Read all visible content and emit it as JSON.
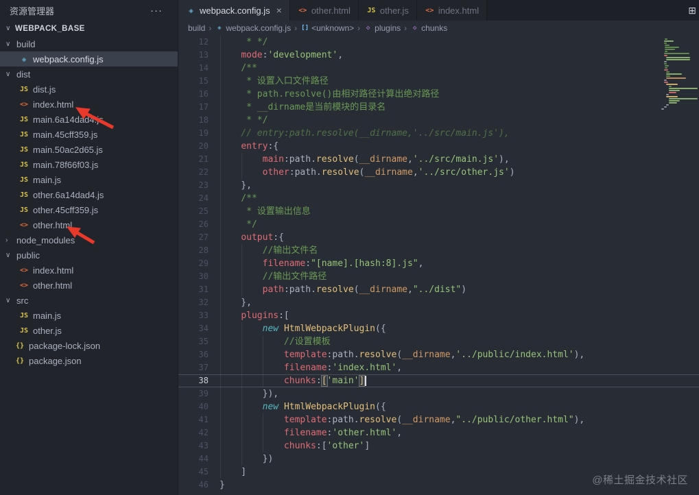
{
  "glyphs": {
    "chevron_down": "∨",
    "chevron_right": "›",
    "more": "···",
    "split_editor": "⊞",
    "close": "×",
    "breadcrumb_sep": "›"
  },
  "colors": {
    "sidebar_bg": "#21252b",
    "editor_bg": "#282c34",
    "selection_bg": "#3a404c",
    "property": "#e06c75",
    "string": "#98c379",
    "comment": "#6a9955",
    "class_fn": "#e5c07b",
    "keyword": "#56b6c2",
    "constant": "#d19a66",
    "annotation_arrow": "#e8392b"
  },
  "sidebar": {
    "title": "资源管理器",
    "section": "WEBPACK_BASE",
    "tree": [
      {
        "label": "build",
        "type": "folder",
        "expanded": true,
        "depth": 0
      },
      {
        "label": "webpack.config.js",
        "type": "webpack",
        "depth": 1,
        "selected": true
      },
      {
        "label": "dist",
        "type": "folder",
        "expanded": true,
        "depth": 0
      },
      {
        "label": "dist.js",
        "type": "js",
        "depth": 1
      },
      {
        "label": "index.html",
        "type": "html",
        "depth": 1,
        "arrow": true
      },
      {
        "label": "main.6a14dad4.js",
        "type": "js",
        "depth": 1
      },
      {
        "label": "main.45cff359.js",
        "type": "js",
        "depth": 1
      },
      {
        "label": "main.50ac2d65.js",
        "type": "js",
        "depth": 1
      },
      {
        "label": "main.78f66f03.js",
        "type": "js",
        "depth": 1
      },
      {
        "label": "main.js",
        "type": "js",
        "depth": 1
      },
      {
        "label": "other.6a14dad4.js",
        "type": "js",
        "depth": 1
      },
      {
        "label": "other.45cff359.js",
        "type": "js",
        "depth": 1
      },
      {
        "label": "other.html",
        "type": "html",
        "depth": 1,
        "arrow": true
      },
      {
        "label": "node_modules",
        "type": "folder",
        "expanded": false,
        "depth": 0
      },
      {
        "label": "public",
        "type": "folder",
        "expanded": true,
        "depth": 0
      },
      {
        "label": "index.html",
        "type": "html",
        "depth": 1
      },
      {
        "label": "other.html",
        "type": "html",
        "depth": 1
      },
      {
        "label": "src",
        "type": "folder",
        "expanded": true,
        "depth": 0
      },
      {
        "label": "main.js",
        "type": "js",
        "depth": 1
      },
      {
        "label": "other.js",
        "type": "js",
        "depth": 1
      },
      {
        "label": "package-lock.json",
        "type": "json",
        "depth": 0,
        "rootfile": true
      },
      {
        "label": "package.json",
        "type": "json",
        "depth": 0,
        "rootfile": true
      }
    ]
  },
  "tabs": [
    {
      "label": "webpack.config.js",
      "icon": "webpack",
      "active": true,
      "close": "×"
    },
    {
      "label": "other.html",
      "icon": "html"
    },
    {
      "label": "other.js",
      "icon": "js"
    },
    {
      "label": "index.html",
      "icon": "html"
    }
  ],
  "breadcrumbs": [
    {
      "label": "build"
    },
    {
      "label": "webpack.config.js",
      "icon": "webpack"
    },
    {
      "label": "<unknown>",
      "icon": "symbol-array"
    },
    {
      "label": "plugins",
      "icon": "symbol-field"
    },
    {
      "label": "chunks",
      "icon": "symbol-field"
    }
  ],
  "editor": {
    "active_line": 38,
    "lines": [
      {
        "n": 12,
        "t": [
          [
            "c",
            "     * */"
          ]
        ]
      },
      {
        "n": 13,
        "t": [
          [
            "p",
            "    "
          ],
          [
            "r",
            "mode"
          ],
          [
            "p",
            ":"
          ],
          [
            "g",
            "'development'"
          ],
          [
            "p",
            ","
          ]
        ]
      },
      {
        "n": 14,
        "t": [
          [
            "c",
            "    /**"
          ]
        ]
      },
      {
        "n": 15,
        "t": [
          [
            "c",
            "     * 设置入口文件路径"
          ]
        ]
      },
      {
        "n": 16,
        "t": [
          [
            "c",
            "     * path.resolve()由相对路径计算出绝对路径"
          ]
        ]
      },
      {
        "n": 17,
        "t": [
          [
            "c",
            "     * __dirname是当前模块的目录名"
          ]
        ]
      },
      {
        "n": 18,
        "t": [
          [
            "c",
            "     * */"
          ]
        ]
      },
      {
        "n": 19,
        "t": [
          [
            "ci",
            "    // entry:path.resolve(__dirname,'../src/main.js'),"
          ]
        ]
      },
      {
        "n": 20,
        "t": [
          [
            "p",
            "    "
          ],
          [
            "r",
            "entry"
          ],
          [
            "p",
            ":{"
          ]
        ]
      },
      {
        "n": 21,
        "t": [
          [
            "p",
            "        "
          ],
          [
            "r",
            "main"
          ],
          [
            "p",
            ":"
          ],
          [
            "v",
            "path"
          ],
          [
            "p",
            "."
          ],
          [
            "y",
            "resolve"
          ],
          [
            "p",
            "("
          ],
          [
            "o",
            "__dirname"
          ],
          [
            "p",
            ","
          ],
          [
            "g",
            "'../src/main.js'"
          ],
          [
            "p",
            "),"
          ]
        ]
      },
      {
        "n": 22,
        "t": [
          [
            "p",
            "        "
          ],
          [
            "r",
            "other"
          ],
          [
            "p",
            ":"
          ],
          [
            "v",
            "path"
          ],
          [
            "p",
            "."
          ],
          [
            "y",
            "resolve"
          ],
          [
            "p",
            "("
          ],
          [
            "o",
            "__dirname"
          ],
          [
            "p",
            ","
          ],
          [
            "g",
            "'../src/other.js'"
          ],
          [
            "p",
            ")"
          ]
        ]
      },
      {
        "n": 23,
        "t": [
          [
            "p",
            "    },"
          ]
        ]
      },
      {
        "n": 24,
        "t": [
          [
            "c",
            "    /**"
          ]
        ]
      },
      {
        "n": 25,
        "t": [
          [
            "c",
            "     * 设置输出信息"
          ]
        ]
      },
      {
        "n": 26,
        "t": [
          [
            "c",
            "     */"
          ]
        ]
      },
      {
        "n": 27,
        "t": [
          [
            "p",
            "    "
          ],
          [
            "r",
            "output"
          ],
          [
            "p",
            ":{"
          ]
        ]
      },
      {
        "n": 28,
        "t": [
          [
            "c",
            "        //输出文件名"
          ]
        ]
      },
      {
        "n": 29,
        "t": [
          [
            "p",
            "        "
          ],
          [
            "r",
            "filename"
          ],
          [
            "p",
            ":"
          ],
          [
            "g",
            "\"[name].[hash:8].js\""
          ],
          [
            "p",
            ","
          ]
        ]
      },
      {
        "n": 30,
        "t": [
          [
            "c",
            "        //输出文件路径"
          ]
        ]
      },
      {
        "n": 31,
        "t": [
          [
            "p",
            "        "
          ],
          [
            "r",
            "path"
          ],
          [
            "p",
            ":"
          ],
          [
            "v",
            "path"
          ],
          [
            "p",
            "."
          ],
          [
            "y",
            "resolve"
          ],
          [
            "p",
            "("
          ],
          [
            "o",
            "__dirname"
          ],
          [
            "p",
            ","
          ],
          [
            "g",
            "\"../dist\""
          ],
          [
            "p",
            ")"
          ]
        ]
      },
      {
        "n": 32,
        "t": [
          [
            "p",
            "    },"
          ]
        ]
      },
      {
        "n": 33,
        "t": [
          [
            "p",
            "    "
          ],
          [
            "r",
            "plugins"
          ],
          [
            "p",
            ":["
          ]
        ]
      },
      {
        "n": 34,
        "t": [
          [
            "p",
            "        "
          ],
          [
            "k",
            "new"
          ],
          [
            "p",
            " "
          ],
          [
            "y",
            "HtmlWebpackPlugin"
          ],
          [
            "p",
            "({"
          ]
        ]
      },
      {
        "n": 35,
        "t": [
          [
            "c",
            "            //设置模板"
          ]
        ]
      },
      {
        "n": 36,
        "t": [
          [
            "p",
            "            "
          ],
          [
            "r",
            "template"
          ],
          [
            "p",
            ":"
          ],
          [
            "v",
            "path"
          ],
          [
            "p",
            "."
          ],
          [
            "y",
            "resolve"
          ],
          [
            "p",
            "("
          ],
          [
            "o",
            "__dirname"
          ],
          [
            "p",
            ","
          ],
          [
            "g",
            "'../public/index.html'"
          ],
          [
            "p",
            "),"
          ]
        ]
      },
      {
        "n": 37,
        "t": [
          [
            "p",
            "            "
          ],
          [
            "r",
            "filename"
          ],
          [
            "p",
            ":"
          ],
          [
            "g",
            "'index.html'"
          ],
          [
            "p",
            ","
          ]
        ]
      },
      {
        "n": 38,
        "t": [
          [
            "p",
            "            "
          ],
          [
            "r",
            "chunks"
          ],
          [
            "p",
            ":"
          ],
          [
            "hb",
            "["
          ],
          [
            "g",
            "'main'"
          ],
          [
            "hb",
            "]"
          ]
        ]
      },
      {
        "n": 39,
        "t": [
          [
            "p",
            "        }),"
          ]
        ]
      },
      {
        "n": 40,
        "t": [
          [
            "p",
            "        "
          ],
          [
            "k",
            "new"
          ],
          [
            "p",
            " "
          ],
          [
            "y",
            "HtmlWebpackPlugin"
          ],
          [
            "p",
            "({"
          ]
        ]
      },
      {
        "n": 41,
        "t": [
          [
            "p",
            "            "
          ],
          [
            "r",
            "template"
          ],
          [
            "p",
            ":"
          ],
          [
            "v",
            "path"
          ],
          [
            "p",
            "."
          ],
          [
            "y",
            "resolve"
          ],
          [
            "p",
            "("
          ],
          [
            "o",
            "__dirname"
          ],
          [
            "p",
            ","
          ],
          [
            "g",
            "\"../public/other.html\""
          ],
          [
            "p",
            "),"
          ]
        ]
      },
      {
        "n": 42,
        "t": [
          [
            "p",
            "            "
          ],
          [
            "r",
            "filename"
          ],
          [
            "p",
            ":"
          ],
          [
            "g",
            "'other.html'"
          ],
          [
            "p",
            ","
          ]
        ]
      },
      {
        "n": 43,
        "t": [
          [
            "p",
            "            "
          ],
          [
            "r",
            "chunks"
          ],
          [
            "p",
            ":["
          ],
          [
            "g",
            "'other'"
          ],
          [
            "p",
            "]"
          ]
        ]
      },
      {
        "n": 44,
        "t": [
          [
            "p",
            "        })"
          ]
        ]
      },
      {
        "n": 45,
        "t": [
          [
            "p",
            "    ]"
          ]
        ]
      },
      {
        "n": 46,
        "t": [
          [
            "p",
            "}"
          ]
        ]
      }
    ]
  },
  "watermark": "@稀土掘金技术社区"
}
